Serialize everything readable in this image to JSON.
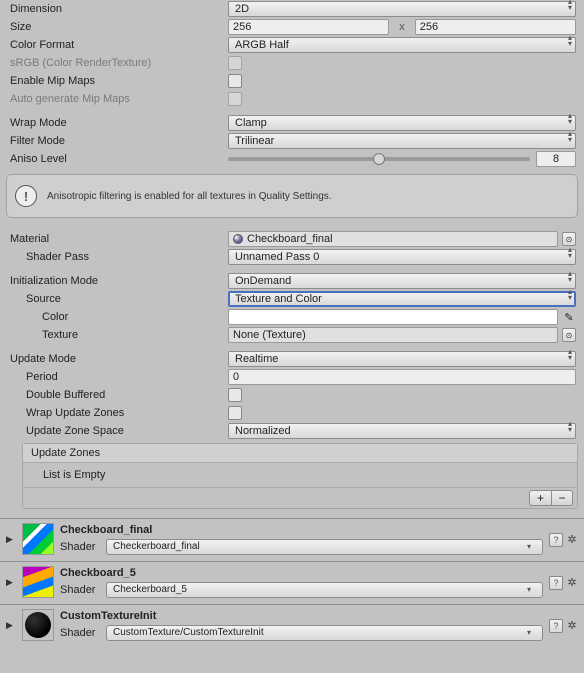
{
  "rows": {
    "dimension": {
      "label": "Dimension",
      "value": "2D"
    },
    "size": {
      "label": "Size",
      "w": "256",
      "h": "256",
      "x": "x"
    },
    "colorFormat": {
      "label": "Color Format",
      "value": "ARGB Half"
    },
    "srgb": {
      "label": "sRGB (Color RenderTexture)"
    },
    "mip": {
      "label": "Enable Mip Maps"
    },
    "autoMip": {
      "label": "Auto generate Mip Maps"
    },
    "wrap": {
      "label": "Wrap Mode",
      "value": "Clamp"
    },
    "filter": {
      "label": "Filter Mode",
      "value": "Trilinear"
    },
    "aniso": {
      "label": "Aniso Level",
      "value": "8"
    }
  },
  "info": "Anisotropic filtering is enabled for all textures in Quality Settings.",
  "material": {
    "label": "Material",
    "value": "Checkboard_final"
  },
  "shaderPass": {
    "label": "Shader Pass",
    "value": "Unnamed Pass 0"
  },
  "init": {
    "mode": {
      "label": "Initialization Mode",
      "value": "OnDemand"
    },
    "source": {
      "label": "Source",
      "value": "Texture and Color"
    },
    "color": {
      "label": "Color"
    },
    "texture": {
      "label": "Texture",
      "value": "None (Texture)"
    }
  },
  "update": {
    "mode": {
      "label": "Update Mode",
      "value": "Realtime"
    },
    "period": {
      "label": "Period",
      "value": "0"
    },
    "doubleBuffered": {
      "label": "Double Buffered"
    },
    "wrapZones": {
      "label": "Wrap Update Zones"
    },
    "zoneSpace": {
      "label": "Update Zone Space",
      "value": "Normalized"
    },
    "zones": {
      "header": "Update Zones",
      "empty": "List is Empty",
      "plus": "+",
      "minus": "−"
    }
  },
  "mats": [
    {
      "name": "Checkboard_final",
      "shaderLabel": "Shader",
      "shader": "Checkerboard_final"
    },
    {
      "name": "Checkboard_5",
      "shaderLabel": "Shader",
      "shader": "Checkerboard_5"
    },
    {
      "name": "CustomTextureInit",
      "shaderLabel": "Shader",
      "shader": "CustomTexture/CustomTextureInit"
    }
  ],
  "obj_picker": "⊙",
  "help_q": "?",
  "gear": "✲"
}
